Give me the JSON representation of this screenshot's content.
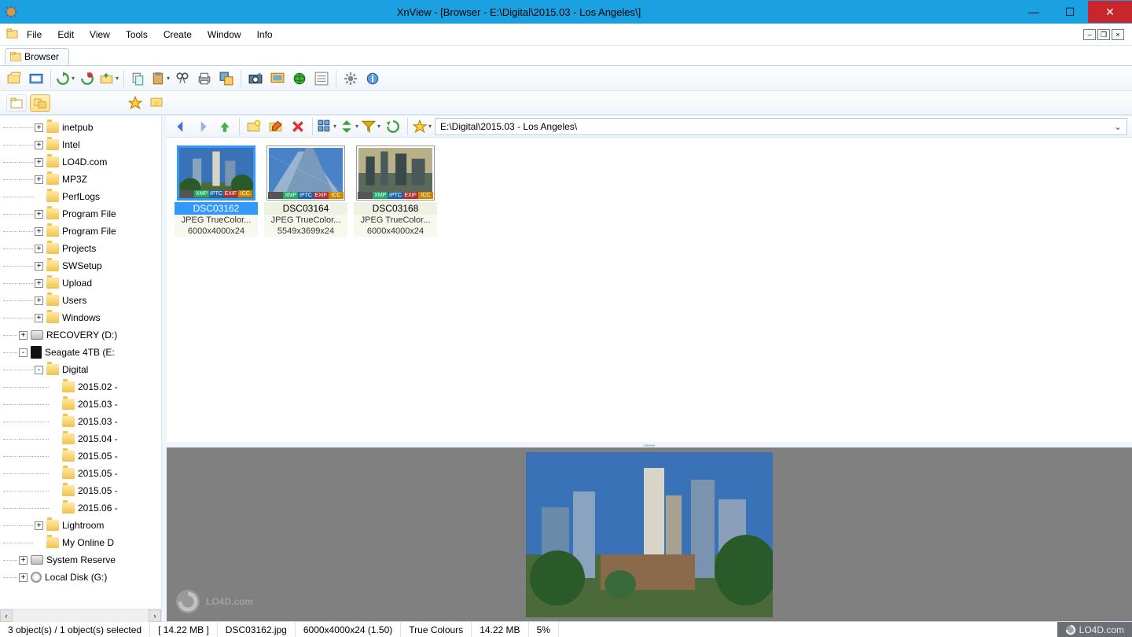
{
  "title": "XnView - [Browser - E:\\Digital\\2015.03 - Los Angeles\\]",
  "menu": [
    "File",
    "Edit",
    "View",
    "Tools",
    "Create",
    "Window",
    "Info"
  ],
  "tab": "Browser",
  "address": "E:\\Digital\\2015.03 - Los Angeles\\",
  "tree": [
    {
      "indent": 2,
      "exp": "+",
      "icon": "folder",
      "label": "inetpub"
    },
    {
      "indent": 2,
      "exp": "+",
      "icon": "folder",
      "label": "Intel"
    },
    {
      "indent": 2,
      "exp": "+",
      "icon": "folder",
      "label": "LO4D.com"
    },
    {
      "indent": 2,
      "exp": "+",
      "icon": "folder",
      "label": "MP3Z"
    },
    {
      "indent": 2,
      "exp": "",
      "icon": "folder",
      "label": "PerfLogs"
    },
    {
      "indent": 2,
      "exp": "+",
      "icon": "folder",
      "label": "Program File"
    },
    {
      "indent": 2,
      "exp": "+",
      "icon": "folder",
      "label": "Program File"
    },
    {
      "indent": 2,
      "exp": "+",
      "icon": "folder",
      "label": "Projects"
    },
    {
      "indent": 2,
      "exp": "+",
      "icon": "folder",
      "label": "SWSetup"
    },
    {
      "indent": 2,
      "exp": "+",
      "icon": "folder",
      "label": "Upload"
    },
    {
      "indent": 2,
      "exp": "+",
      "icon": "folder",
      "label": "Users"
    },
    {
      "indent": 2,
      "exp": "+",
      "icon": "folder",
      "label": "Windows"
    },
    {
      "indent": 1,
      "exp": "+",
      "icon": "drive",
      "label": "RECOVERY (D:)"
    },
    {
      "indent": 1,
      "exp": "-",
      "icon": "darkdrive",
      "label": "Seagate 4TB (E:"
    },
    {
      "indent": 2,
      "exp": "-",
      "icon": "folder",
      "label": "Digital"
    },
    {
      "indent": 3,
      "exp": "",
      "icon": "folder",
      "label": "2015.02 -"
    },
    {
      "indent": 3,
      "exp": "",
      "icon": "folder",
      "label": "2015.03 -"
    },
    {
      "indent": 3,
      "exp": "",
      "icon": "folder",
      "label": "2015.03 -"
    },
    {
      "indent": 3,
      "exp": "",
      "icon": "folder",
      "label": "2015.04 -"
    },
    {
      "indent": 3,
      "exp": "",
      "icon": "folder",
      "label": "2015.05 -"
    },
    {
      "indent": 3,
      "exp": "",
      "icon": "folder",
      "label": "2015.05 -"
    },
    {
      "indent": 3,
      "exp": "",
      "icon": "folder",
      "label": "2015.05 -"
    },
    {
      "indent": 3,
      "exp": "",
      "icon": "folder",
      "label": "2015.06 -"
    },
    {
      "indent": 2,
      "exp": "+",
      "icon": "folder",
      "label": "Lightroom"
    },
    {
      "indent": 2,
      "exp": "",
      "icon": "folder",
      "label": "My Online D"
    },
    {
      "indent": 1,
      "exp": "+",
      "icon": "drive",
      "label": "System Reserve"
    },
    {
      "indent": 1,
      "exp": "+",
      "icon": "cd",
      "label": "Local Disk (G:)"
    }
  ],
  "thumbs": [
    {
      "name": "DSC03162",
      "meta1": "JPEG TrueColor...",
      "meta2": "6000x4000x24",
      "selected": true
    },
    {
      "name": "DSC03164",
      "meta1": "JPEG TrueColor...",
      "meta2": "5549x3699x24",
      "selected": false
    },
    {
      "name": "DSC03168",
      "meta1": "JPEG TrueColor...",
      "meta2": "6000x4000x24",
      "selected": false
    }
  ],
  "badges": [
    "",
    "XMP",
    "IPTC",
    "EXIF",
    "ICC"
  ],
  "status": {
    "objects": "3 object(s) / 1 object(s) selected",
    "size": "[ 14.22 MB ]",
    "file": "DSC03162.jpg",
    "dims": "6000x4000x24 (1.50)",
    "color": "True Colours",
    "fsize": "14.22 MB",
    "zoom": "5%",
    "brand": "LO4D.com"
  },
  "watermark": "LO4D.com"
}
